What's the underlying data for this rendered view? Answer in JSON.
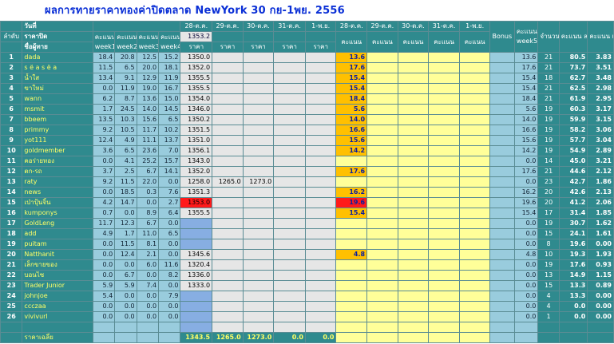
{
  "title": "ผลการทายราคาทองค่าปิดตลาด NewYork 30 กย-1พย. 2556",
  "header": {
    "rank_label": "ลำดับ",
    "date_label": "วันที่",
    "close_price_label": "ราคาปิด",
    "player_label": "ชื่อผู้ทาย",
    "score_label": "คะแนน",
    "week_labels": [
      "week1",
      "week2",
      "week3",
      "week4"
    ],
    "dates": [
      "28-ต.ค.",
      "29-ต.ค.",
      "30-ต.ค.",
      "31-ต.ค.",
      "1-พ.ย."
    ],
    "close_price_28": "1353.2",
    "price_label": "ราคา",
    "bonus_label": "Bonus week5",
    "week5_label": "week5",
    "count_label": "จำนวน ครั้ง",
    "total_label": "คะแนน สะสม",
    "avg_label": "คะแนน เฉลี่ย"
  },
  "rows": [
    {
      "rank": "1",
      "name": "dada",
      "w": [
        "18.4",
        "20.8",
        "12.5",
        "15.2"
      ],
      "p28": "1350.0",
      "p29": "",
      "p30": "",
      "s28": "13.6",
      "w5": "13.6",
      "cnt": "21",
      "tot": "80.5",
      "avg": "3.83"
    },
    {
      "rank": "2",
      "name": "s ë a s ë a",
      "w": [
        "11.5",
        "6.5",
        "20.0",
        "18.1"
      ],
      "p28": "1352.0",
      "p29": "",
      "p30": "",
      "s28": "17.6",
      "w5": "17.6",
      "cnt": "21",
      "tot": "73.7",
      "avg": "3.51"
    },
    {
      "rank": "3",
      "name": "น้ำใส",
      "w": [
        "13.4",
        "9.1",
        "12.9",
        "11.9"
      ],
      "p28": "1355.5",
      "p29": "",
      "p30": "",
      "s28": "15.4",
      "w5": "15.4",
      "cnt": "18",
      "tot": "62.7",
      "avg": "3.48"
    },
    {
      "rank": "4",
      "name": "ขาใหม่",
      "w": [
        "0.0",
        "11.9",
        "19.0",
        "16.7"
      ],
      "p28": "1355.5",
      "p29": "",
      "p30": "",
      "s28": "15.4",
      "w5": "15.4",
      "cnt": "21",
      "tot": "62.5",
      "avg": "2.98"
    },
    {
      "rank": "5",
      "name": "wann",
      "w": [
        "6.2",
        "8.7",
        "13.6",
        "15.0"
      ],
      "p28": "1354.0",
      "p29": "",
      "p30": "",
      "s28": "18.4",
      "w5": "18.4",
      "cnt": "21",
      "tot": "61.9",
      "avg": "2.95"
    },
    {
      "rank": "6",
      "name": "msmit",
      "w": [
        "1.7",
        "24.5",
        "14.0",
        "14.5"
      ],
      "p28": "1346.0",
      "p29": "",
      "p30": "",
      "s28": "5.6",
      "w5": "5.6",
      "cnt": "19",
      "tot": "60.3",
      "avg": "3.17"
    },
    {
      "rank": "7",
      "name": "bbeem",
      "w": [
        "13.5",
        "10.3",
        "15.6",
        "6.5"
      ],
      "p28": "1350.2",
      "p29": "",
      "p30": "",
      "s28": "14.0",
      "w5": "14.0",
      "cnt": "19",
      "tot": "59.9",
      "avg": "3.15"
    },
    {
      "rank": "8",
      "name": "primmy",
      "w": [
        "9.2",
        "10.5",
        "11.7",
        "10.2"
      ],
      "p28": "1351.5",
      "p29": "",
      "p30": "",
      "s28": "16.6",
      "w5": "16.6",
      "cnt": "19",
      "tot": "58.2",
      "avg": "3.06"
    },
    {
      "rank": "9",
      "name": "yot111",
      "w": [
        "12.4",
        "4.9",
        "11.1",
        "13.7"
      ],
      "p28": "1351.0",
      "p29": "",
      "p30": "",
      "s28": "15.6",
      "w5": "15.6",
      "cnt": "19",
      "tot": "57.7",
      "avg": "3.04"
    },
    {
      "rank": "10",
      "name": "goldmember",
      "w": [
        "3.6",
        "6.5",
        "23.6",
        "7.0"
      ],
      "p28": "1356.1",
      "p29": "",
      "p30": "",
      "s28": "14.2",
      "w5": "14.2",
      "cnt": "19",
      "tot": "54.9",
      "avg": "2.89"
    },
    {
      "rank": "11",
      "name": "คอร่ายทอง",
      "w": [
        "0.0",
        "4.1",
        "25.2",
        "15.7"
      ],
      "p28": "1343.0",
      "p29": "",
      "p30": "",
      "s28": "",
      "w5": "0.0",
      "cnt": "14",
      "tot": "45.0",
      "avg": "3.21"
    },
    {
      "rank": "12",
      "name": "ตก-รถ",
      "w": [
        "3.7",
        "2.5",
        "6.7",
        "14.1"
      ],
      "p28": "1352.0",
      "p29": "",
      "p30": "",
      "s28": "17.6",
      "w5": "17.6",
      "cnt": "21",
      "tot": "44.6",
      "avg": "2.12"
    },
    {
      "rank": "13",
      "name": "raty",
      "w": [
        "9.2",
        "11.5",
        "22.0",
        "0.0"
      ],
      "p28": "1258.0",
      "p29": "1265.0",
      "p30": "1273.0",
      "s28": "",
      "w5": "0.0",
      "cnt": "23",
      "tot": "42.7",
      "avg": "1.86"
    },
    {
      "rank": "14",
      "name": "news",
      "w": [
        "0.0",
        "18.5",
        "0.3",
        "7.6"
      ],
      "p28": "1351.3",
      "p29": "",
      "p30": "",
      "s28": "16.2",
      "w5": "16.2",
      "cnt": "20",
      "tot": "42.6",
      "avg": "2.13"
    },
    {
      "rank": "15",
      "name": "เป่าปุ้นจิ้น",
      "w": [
        "4.2",
        "14.7",
        "0.0",
        "2.7"
      ],
      "p28": "1353.0",
      "p29": "",
      "p30": "",
      "s28": "19.6",
      "w5": "19.6",
      "cnt": "20",
      "tot": "41.2",
      "avg": "2.06"
    },
    {
      "rank": "16",
      "name": "kumponys",
      "w": [
        "0.7",
        "0.0",
        "8.9",
        "6.4"
      ],
      "p28": "1355.5",
      "p29": "",
      "p30": "",
      "s28": "15.4",
      "w5": "15.4",
      "cnt": "17",
      "tot": "31.4",
      "avg": "1.85"
    },
    {
      "rank": "17",
      "name": "GoldLeng",
      "w": [
        "11.7",
        "12.3",
        "6.7",
        "0.0"
      ],
      "p28": "",
      "p29": "",
      "p30": "",
      "s28": "",
      "w5": "0.0",
      "cnt": "19",
      "tot": "30.7",
      "avg": "1.62"
    },
    {
      "rank": "18",
      "name": "add",
      "w": [
        "4.9",
        "1.7",
        "11.0",
        "6.5"
      ],
      "p28": "",
      "p29": "",
      "p30": "",
      "s28": "",
      "w5": "0.0",
      "cnt": "15",
      "tot": "24.1",
      "avg": "1.61"
    },
    {
      "rank": "19",
      "name": "puitam",
      "w": [
        "0.0",
        "11.5",
        "8.1",
        "0.0"
      ],
      "p28": "",
      "p29": "",
      "p30": "",
      "s28": "",
      "w5": "0.0",
      "cnt": "8",
      "tot": "19.6",
      "avg": "0.00"
    },
    {
      "rank": "20",
      "name": "Natthanit",
      "w": [
        "0.0",
        "12.4",
        "2.1",
        "0.0"
      ],
      "p28": "1345.6",
      "p29": "",
      "p30": "",
      "s28": "4.8",
      "w5": "4.8",
      "cnt": "10",
      "tot": "19.3",
      "avg": "1.93"
    },
    {
      "rank": "21",
      "name": "เล็กขายของ",
      "w": [
        "0.0",
        "0.0",
        "6.0",
        "11.6"
      ],
      "p28": "1320.4",
      "p29": "",
      "p30": "",
      "s28": "",
      "w5": "0.0",
      "cnt": "19",
      "tot": "17.6",
      "avg": "0.93"
    },
    {
      "rank": "22",
      "name": "บอนไซ",
      "w": [
        "0.0",
        "6.7",
        "0.0",
        "8.2"
      ],
      "p28": "1336.0",
      "p29": "",
      "p30": "",
      "s28": "",
      "w5": "0.0",
      "cnt": "13",
      "tot": "14.9",
      "avg": "1.15"
    },
    {
      "rank": "23",
      "name": "Trader Junior",
      "w": [
        "5.9",
        "5.9",
        "7.4",
        "0.0"
      ],
      "p28": "1333.0",
      "p29": "",
      "p30": "",
      "s28": "",
      "w5": "0.0",
      "cnt": "15",
      "tot": "13.3",
      "avg": "0.89"
    },
    {
      "rank": "24",
      "name": "johnjoe",
      "w": [
        "5.4",
        "0.0",
        "0.0",
        "7.9"
      ],
      "p28": "",
      "p29": "",
      "p30": "",
      "s28": "",
      "w5": "0.0",
      "cnt": "4",
      "tot": "13.3",
      "avg": "0.00"
    },
    {
      "rank": "25",
      "name": "ccczaa",
      "w": [
        "0.0",
        "0.0",
        "0.0",
        "0.0"
      ],
      "p28": "",
      "p29": "",
      "p30": "",
      "s28": "",
      "w5": "0.0",
      "cnt": "4",
      "tot": "0.0",
      "avg": "0.00"
    },
    {
      "rank": "26",
      "name": "vivivurl",
      "w": [
        "0.0",
        "0.0",
        "0.0",
        "0.0"
      ],
      "p28": "",
      "p29": "",
      "p30": "",
      "s28": "",
      "w5": "0.0",
      "cnt": "1",
      "tot": "0.0",
      "avg": "0.00"
    }
  ],
  "summary": {
    "label": "ราคาเฉลี่ย",
    "avg": [
      "1343.5",
      "1265.0",
      "1273.0",
      "0.0",
      "0.0"
    ]
  },
  "colors": {
    "teal": "#2f8a8e",
    "light_blue": "#99ccdd",
    "price_blue": "#87aee2",
    "yellow": "#ffff99",
    "orange": "#ffc000",
    "red": "#ff1a1a",
    "name_yellow": "#ffff66",
    "title_blue": "#0a2fd6"
  }
}
